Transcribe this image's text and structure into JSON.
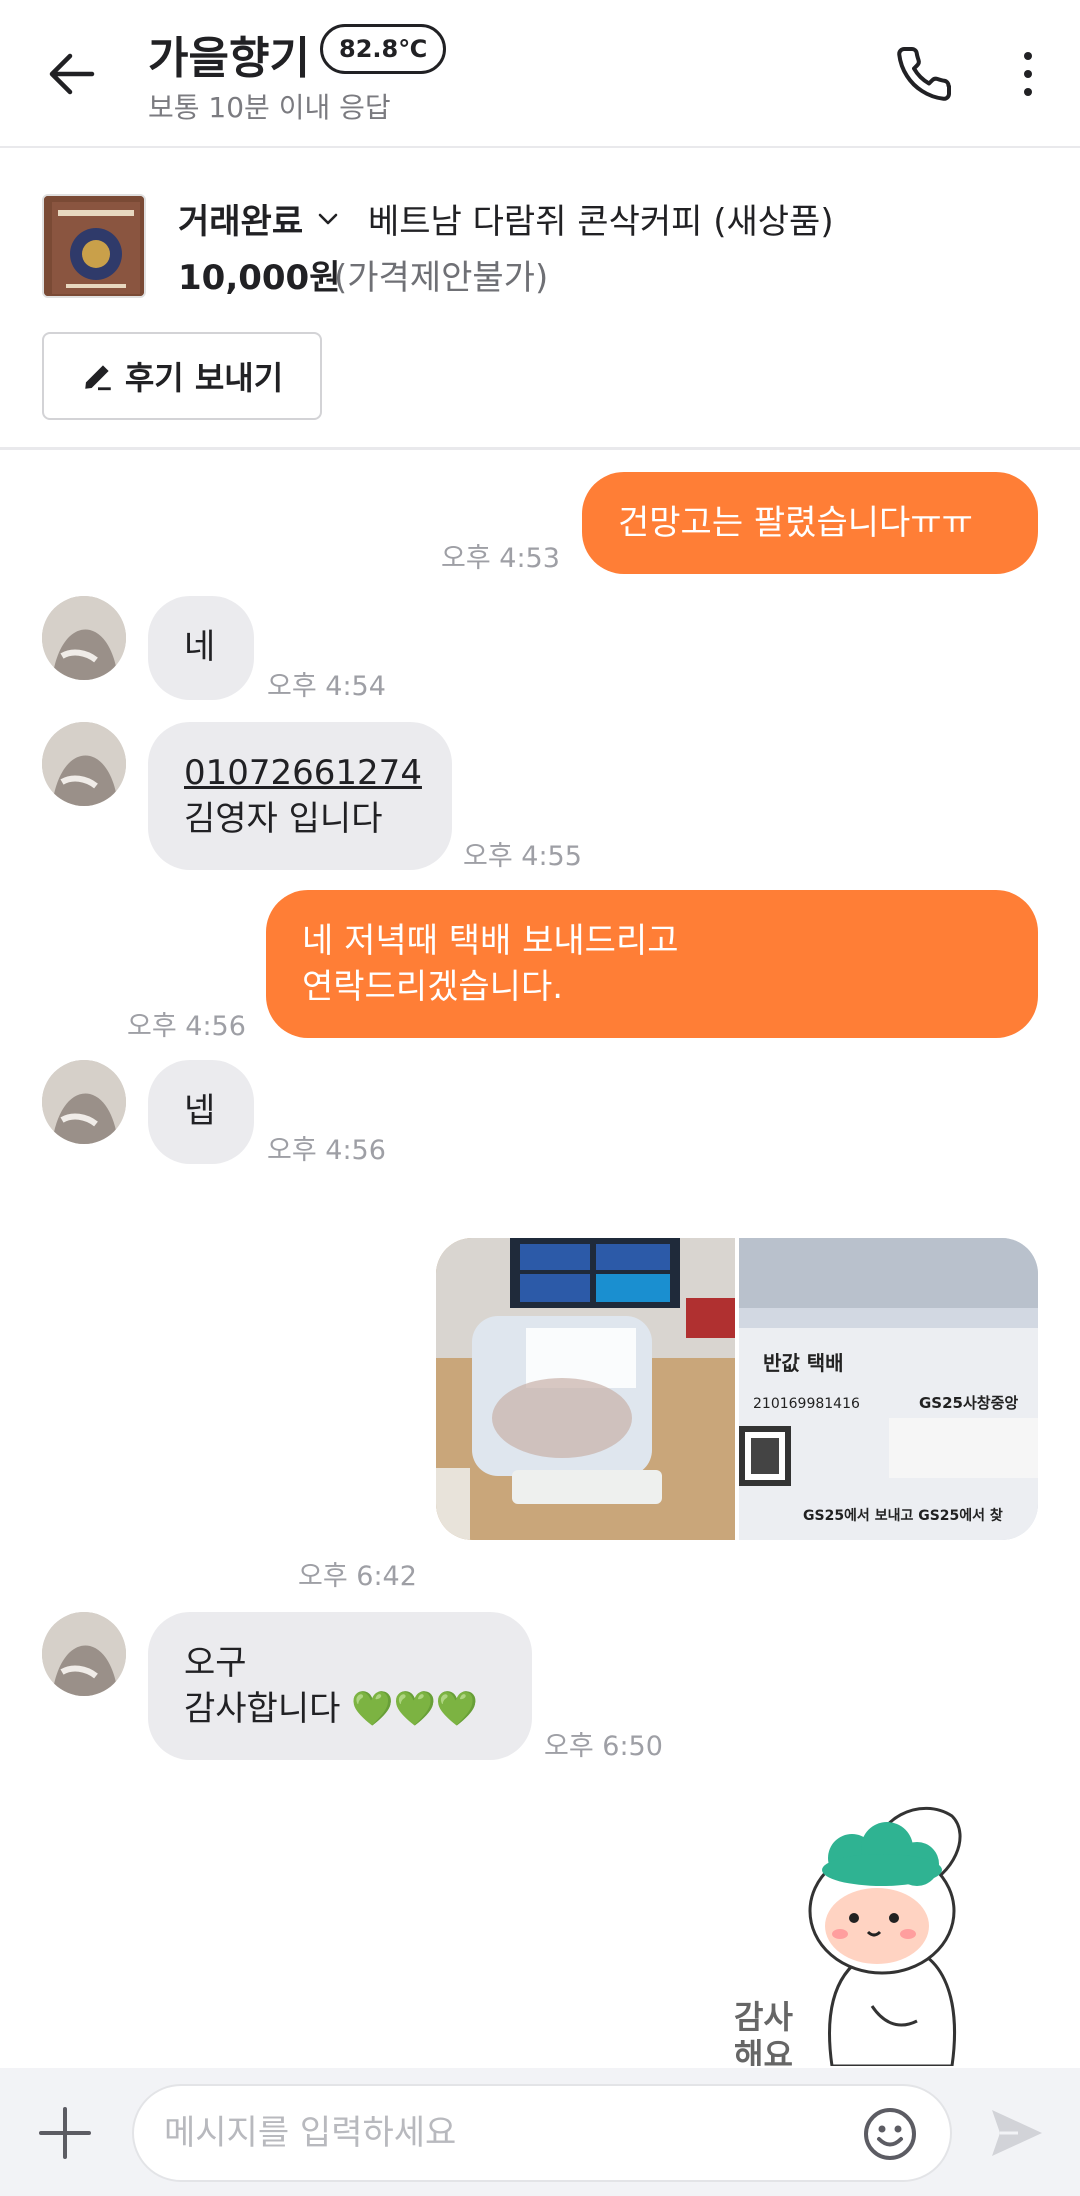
{
  "header": {
    "title": "가을향기",
    "temperature": "82.8℃",
    "subtitle": "보통 10분 이내 응답"
  },
  "product": {
    "status": "거래완료",
    "title": "베트남 다람쥐 콘삭커피 (새상품)",
    "price": "10,000원",
    "price_note": "(가격제안불가)",
    "review_button": "후기 보내기"
  },
  "messages": [
    {
      "from": "me",
      "text": "건망고는 팔렸습니다ㅠㅠ",
      "time": "오후 4:53"
    },
    {
      "from": "other",
      "text": "네",
      "time": "오후 4:54"
    },
    {
      "from": "other",
      "phone": "01072661274",
      "text": "김영자 입니다",
      "time": "오후 4:55"
    },
    {
      "from": "me",
      "line1": "네  저녁때 택배 보내드리고",
      "line2": "연락드리겠습니다.",
      "time": "오후 4:56"
    },
    {
      "from": "other",
      "text": "넵",
      "time": "오후 4:56"
    },
    {
      "from": "me",
      "type": "photos",
      "time": "오후 6:42"
    },
    {
      "from": "other",
      "line1": "오구",
      "line2": "감사합니다 💚💚💚",
      "time": "오후 6:50"
    }
  ],
  "photo2_text": {
    "label": "반값 택배",
    "tracking": "210169981416",
    "store": "GS25사창중앙",
    "footer": "GS25에서 보내고 GS25에서 찾"
  },
  "sticker": {
    "text_line1": "감사",
    "text_line2": "해요"
  },
  "input": {
    "placeholder": "메시지를 입력하세요"
  },
  "colors": {
    "accent": "#ff7e36",
    "incoming_bubble": "#ebebee",
    "muted_text": "#9e9fa5"
  }
}
